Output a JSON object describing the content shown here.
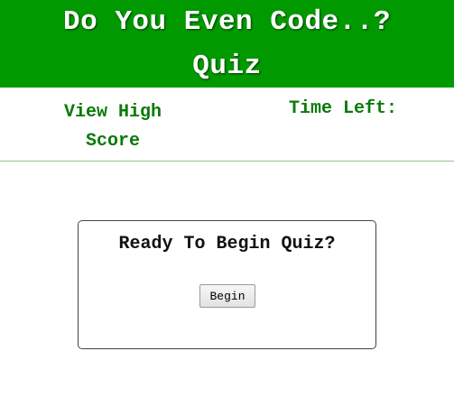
{
  "header": {
    "title_line1": "Do You Even Code..?",
    "title_line2": "Quiz",
    "background_color": "#009a00"
  },
  "nav": {
    "high_score_line1": "View High",
    "high_score_line2": "Score",
    "time_left_label": "Time Left:",
    "text_color": "#0a7a0a"
  },
  "start_card": {
    "heading": "Ready To Begin Quiz?",
    "begin_label": "Begin"
  }
}
